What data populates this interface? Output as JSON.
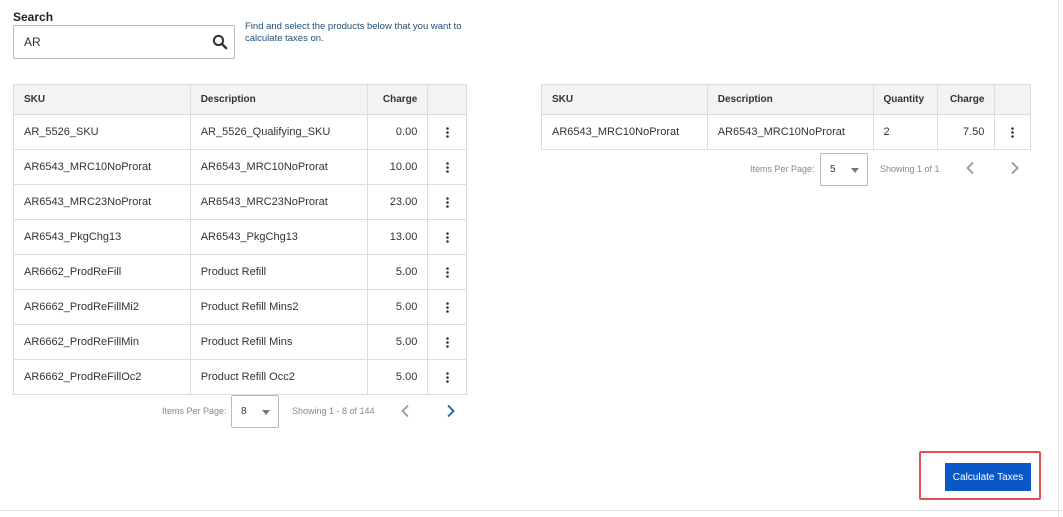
{
  "search": {
    "label": "Search",
    "value": "AR",
    "hint": "Find and select the products below that you want to calculate taxes on."
  },
  "products_table": {
    "headers": {
      "sku": "SKU",
      "description": "Description",
      "charge": "Charge"
    },
    "rows": [
      {
        "sku": "AR_5526_SKU",
        "description": "AR_5526_Qualifying_SKU",
        "charge": "0.00"
      },
      {
        "sku": "AR6543_MRC10NoProrat",
        "description": "AR6543_MRC10NoProrat",
        "charge": "10.00"
      },
      {
        "sku": "AR6543_MRC23NoProrat",
        "description": "AR6543_MRC23NoProrat",
        "charge": "23.00"
      },
      {
        "sku": "AR6543_PkgChg13",
        "description": "AR6543_PkgChg13",
        "charge": "13.00"
      },
      {
        "sku": "AR6662_ProdReFill",
        "description": "Product Refill",
        "charge": "5.00"
      },
      {
        "sku": "AR6662_ProdReFillMi2",
        "description": "Product Refill Mins2",
        "charge": "5.00"
      },
      {
        "sku": "AR6662_ProdReFillMin",
        "description": "Product Refill Mins",
        "charge": "5.00"
      },
      {
        "sku": "AR6662_ProdReFillOc2",
        "description": "Product Refill Occ2",
        "charge": "5.00"
      }
    ],
    "pager": {
      "items_per_page_label": "Items Per Page:",
      "items_per_page": "8",
      "showing": "Showing 1 - 8 of 144"
    }
  },
  "selected_table": {
    "headers": {
      "sku": "SKU",
      "description": "Description",
      "quantity": "Quantity",
      "charge": "Charge"
    },
    "rows": [
      {
        "sku": "AR6543_MRC10NoProrat",
        "description": "AR6543_MRC10NoProrat",
        "quantity": "2",
        "charge": "7.50"
      }
    ],
    "pager": {
      "items_per_page_label": "Items Per Page:",
      "items_per_page": "5",
      "showing": "Showing 1 of 1"
    }
  },
  "actions": {
    "calculate_label": "Calculate Taxes"
  },
  "colors": {
    "primary": "#0a57c7",
    "highlight": "#e05252",
    "hint_text": "#1f4e79",
    "arrow_active": "#1a5fb4",
    "arrow_disabled": "#999999"
  }
}
